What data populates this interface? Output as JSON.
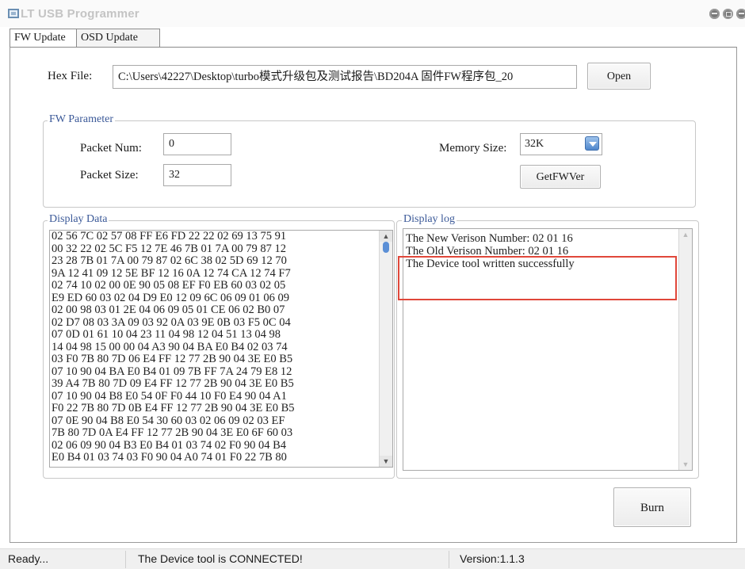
{
  "window": {
    "title": "LT USB Programmer"
  },
  "tabs": [
    {
      "label": "FW Update",
      "active": true
    },
    {
      "label": "OSD Update",
      "active": false
    }
  ],
  "hex_file": {
    "label": "Hex File:",
    "value": "C:\\Users\\42227\\Desktop\\turbo模式升级包及测试报告\\BD204A 固件FW程序包_20",
    "open_label": "Open"
  },
  "fw_parameter": {
    "title": "FW Parameter",
    "packet_num_label": "Packet Num:",
    "packet_num_value": "0",
    "packet_size_label": "Packet Size:",
    "packet_size_value": "32",
    "memory_size_label": "Memory Size:",
    "memory_size_value": "32K",
    "getfwver_label": "GetFWVer"
  },
  "display_data": {
    "title": "Display Data",
    "lines": [
      "02 56 7C 02 57 08 FF E6 FD 22 22 02 69 13 75 91",
      "00 32 22 02 5C F5 12 7E 46 7B 01 7A 00 79 87 12",
      "23 28 7B 01 7A 00 79 87 02 6C 38 02 5D 69 12 70",
      "9A 12 41 09 12 5E BF 12 16 0A 12 74 CA 12 74 F7",
      "02 74 10 02 00 0E 90 05 08 EF F0 EB 60 03 02 05",
      "E9 ED 60 03 02 04 D9 E0 12 09 6C 06 09 01 06 09",
      "02 00 98 03 01 2E 04 06 09 05 01 CE 06 02 B0 07",
      "02 D7 08 03 3A 09 03 92 0A 03 9E 0B 03 F5 0C 04",
      "07 0D 01 61 10 04 23 11 04 98 12 04 51 13 04 98",
      "14 04 98 15 00 00 04 A3 90 04 BA E0 B4 02 03 74",
      "03 F0 7B 80 7D 06 E4 FF 12 77 2B 90 04 3E E0 B5",
      "07 10 90 04 BA E0 B4 01 09 7B FF 7A 24 79 E8 12",
      "39 A4 7B 80 7D 09 E4 FF 12 77 2B 90 04 3E E0 B5",
      "07 10 90 04 B8 E0 54 0F F0 44 10 F0 E4 90 04 A1",
      "F0 22 7B 80 7D 0B E4 FF 12 77 2B 90 04 3E E0 B5",
      "07 0E 90 04 B8 E0 54 30 60 03 02 06 09 02 03 EF",
      "7B 80 7D 0A E4 FF 12 77 2B 90 04 3E E0 6F 60 03",
      "02 06 09 90 04 B3 E0 B4 01 03 74 02 F0 90 04 B4",
      "E0 B4 01 03 74 03 F0 90 04 A0 74 01 F0 22 7B 80"
    ]
  },
  "display_log": {
    "title": "Display log",
    "lines": [
      "The New Verison Number: 02 01 16",
      "The Old Verison Number: 02 01 16",
      "The Device tool written successfully"
    ]
  },
  "burn_label": "Burn",
  "status": {
    "state": "Ready...",
    "connection": "The Device tool is CONNECTED!",
    "version": "Version:1.1.3"
  },
  "colors": {
    "highlight": "#e0473a",
    "scroll_thumb": "#5b8fd6",
    "legend_text": "#3b5998"
  }
}
